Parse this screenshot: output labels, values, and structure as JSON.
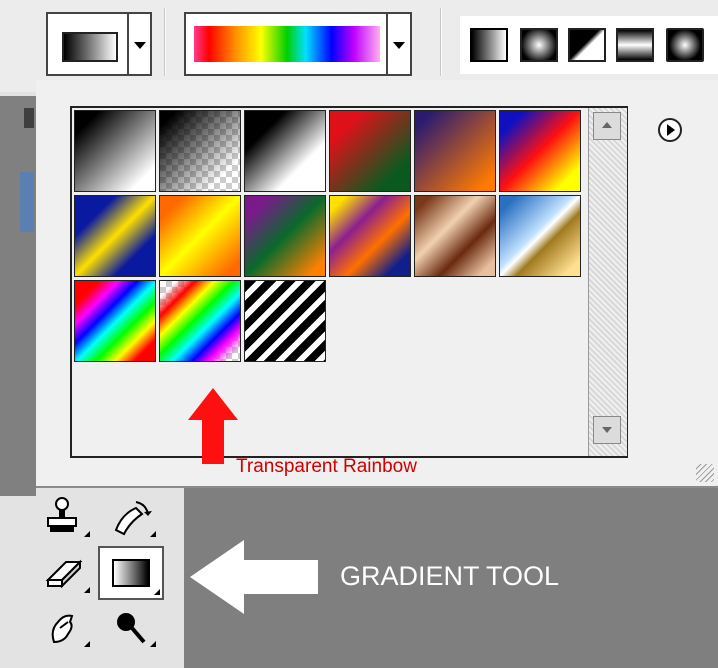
{
  "options_bar": {
    "gradient_picker": {
      "icon": "gradient-swatch-icon"
    },
    "current_gradient": {
      "name": "Transparent Rainbow"
    },
    "gradient_types": [
      {
        "id": "linear",
        "icon": "linear-gradient-icon"
      },
      {
        "id": "radial",
        "icon": "radial-gradient-icon"
      },
      {
        "id": "angle",
        "icon": "angle-gradient-icon"
      },
      {
        "id": "reflected",
        "icon": "reflected-gradient-icon"
      },
      {
        "id": "diamond",
        "icon": "diamond-gradient-icon"
      }
    ]
  },
  "gradient_panel": {
    "presets": [
      {
        "id": "foreground-to-background",
        "css": "linear-gradient(135deg,#000 15%,#fff 85%)"
      },
      {
        "id": "foreground-to-transparent",
        "css": "linear-gradient(135deg,rgba(0,0,0,1) 10%,rgba(0,0,0,0) 80%)",
        "checker": true
      },
      {
        "id": "black-white",
        "css": "linear-gradient(135deg,#000 25%,#fff 70%)"
      },
      {
        "id": "red-green",
        "css": "linear-gradient(135deg,#e0101a 20%,#0a5a1f 80%)"
      },
      {
        "id": "violet-orange",
        "css": "linear-gradient(135deg,#2a1a70 10%,#ff7a00 90%)"
      },
      {
        "id": "blue-red-yellow",
        "css": "linear-gradient(135deg,#1010c0 15%,#ff1010 50%,#ffff00 85%)"
      },
      {
        "id": "blue-yellow-blue",
        "css": "linear-gradient(135deg,#0a1aa0 25%,#ffe000 50%,#0a1aa0 75%)"
      },
      {
        "id": "orange-yellow-orange",
        "css": "linear-gradient(135deg,#ff6a00 15%,#ffff00 50%,#ff6a00 90%)"
      },
      {
        "id": "violet-green-orange",
        "css": "linear-gradient(135deg,#7a1a8a 15%,#0a6a2a 50%,#ff8000 90%)"
      },
      {
        "id": "yellow-violet-orange-blue",
        "css": "linear-gradient(135deg,#ffe000 10%,#8a2090 35%,#ff7000 60%,#10208a 85%)"
      },
      {
        "id": "copper",
        "css": "linear-gradient(135deg,#7a3a1a 10%,#f0d0b0 40%,#6a2a10 65%,#e8c0a0 90%)"
      },
      {
        "id": "chrome",
        "css": "linear-gradient(135deg,#2a70c0 10%,#c0e0ff 45%,#ffffff 50%,#a07a20 60%,#ffe090 90%)"
      },
      {
        "id": "spectrum",
        "css": "linear-gradient(135deg,#ff0000 15%,#ff00ff 27%,#0000ff 39%,#00ffff 51%,#00ff00 63%,#ffff00 75%,#ff0000 87%)"
      },
      {
        "id": "transparent-rainbow",
        "css": "linear-gradient(135deg,rgba(255,0,0,0) 10%,#ff0000 22%,#ffff00 34%,#00ff00 46%,#00ffff 58%,#0000ff 70%,#ff00ff 80%,rgba(255,0,255,0) 92%)",
        "checker": true
      },
      {
        "id": "transparent-stripes",
        "css": "repeating-linear-gradient(135deg,#000 0 8px,#fff 8px 14px)"
      }
    ],
    "menu_icon": "play-circle-icon",
    "annotation": "Transparent Rainbow"
  },
  "toolbox": {
    "tools": [
      {
        "id": "clone-stamp",
        "icon": "stamp-icon"
      },
      {
        "id": "history-brush",
        "icon": "history-brush-icon"
      },
      {
        "id": "eraser",
        "icon": "eraser-icon"
      },
      {
        "id": "gradient",
        "icon": "gradient-tool-icon",
        "selected": true
      },
      {
        "id": "smudge",
        "icon": "smudge-icon"
      },
      {
        "id": "dodge",
        "icon": "dodge-icon"
      }
    ],
    "annotation": "GRADIENT TOOL"
  }
}
